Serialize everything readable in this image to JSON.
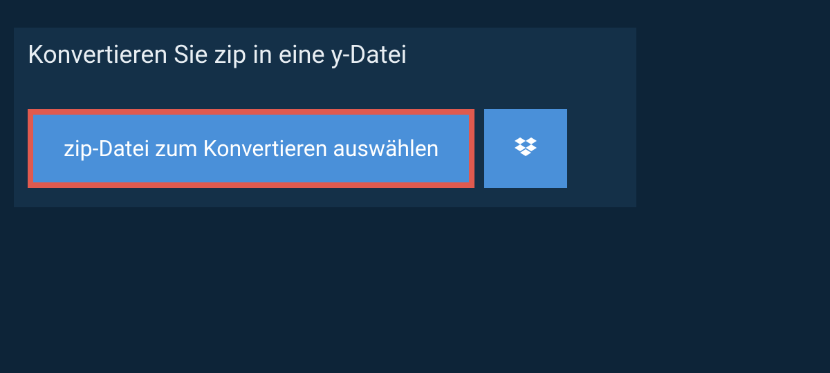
{
  "title": "Konvertieren Sie zip in eine y-Datei",
  "buttons": {
    "select_file": "zip-Datei zum Konvertieren auswählen"
  },
  "colors": {
    "background": "#0d2438",
    "panel": "#143048",
    "button": "#4a90d9",
    "highlight_border": "#e05a4f",
    "text_light": "#e8eef3",
    "text_white": "#ffffff"
  }
}
